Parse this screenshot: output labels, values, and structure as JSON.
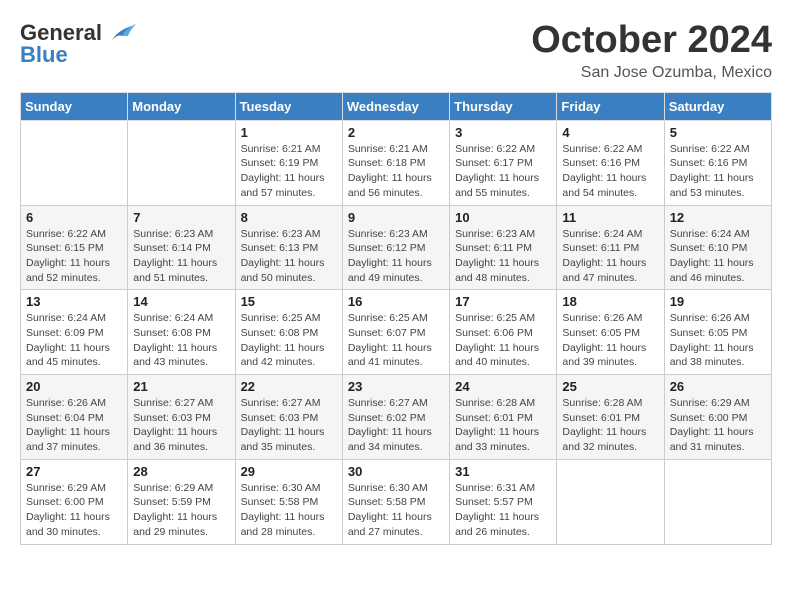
{
  "header": {
    "logo": {
      "line1": "General",
      "line2": "Blue"
    },
    "title": "October 2024",
    "location": "San Jose Ozumba, Mexico"
  },
  "weekdays": [
    "Sunday",
    "Monday",
    "Tuesday",
    "Wednesday",
    "Thursday",
    "Friday",
    "Saturday"
  ],
  "weeks": [
    [
      null,
      null,
      {
        "day": "1",
        "sunrise": "Sunrise: 6:21 AM",
        "sunset": "Sunset: 6:19 PM",
        "daylight": "Daylight: 11 hours and 57 minutes."
      },
      {
        "day": "2",
        "sunrise": "Sunrise: 6:21 AM",
        "sunset": "Sunset: 6:18 PM",
        "daylight": "Daylight: 11 hours and 56 minutes."
      },
      {
        "day": "3",
        "sunrise": "Sunrise: 6:22 AM",
        "sunset": "Sunset: 6:17 PM",
        "daylight": "Daylight: 11 hours and 55 minutes."
      },
      {
        "day": "4",
        "sunrise": "Sunrise: 6:22 AM",
        "sunset": "Sunset: 6:16 PM",
        "daylight": "Daylight: 11 hours and 54 minutes."
      },
      {
        "day": "5",
        "sunrise": "Sunrise: 6:22 AM",
        "sunset": "Sunset: 6:16 PM",
        "daylight": "Daylight: 11 hours and 53 minutes."
      }
    ],
    [
      {
        "day": "6",
        "sunrise": "Sunrise: 6:22 AM",
        "sunset": "Sunset: 6:15 PM",
        "daylight": "Daylight: 11 hours and 52 minutes."
      },
      {
        "day": "7",
        "sunrise": "Sunrise: 6:23 AM",
        "sunset": "Sunset: 6:14 PM",
        "daylight": "Daylight: 11 hours and 51 minutes."
      },
      {
        "day": "8",
        "sunrise": "Sunrise: 6:23 AM",
        "sunset": "Sunset: 6:13 PM",
        "daylight": "Daylight: 11 hours and 50 minutes."
      },
      {
        "day": "9",
        "sunrise": "Sunrise: 6:23 AM",
        "sunset": "Sunset: 6:12 PM",
        "daylight": "Daylight: 11 hours and 49 minutes."
      },
      {
        "day": "10",
        "sunrise": "Sunrise: 6:23 AM",
        "sunset": "Sunset: 6:11 PM",
        "daylight": "Daylight: 11 hours and 48 minutes."
      },
      {
        "day": "11",
        "sunrise": "Sunrise: 6:24 AM",
        "sunset": "Sunset: 6:11 PM",
        "daylight": "Daylight: 11 hours and 47 minutes."
      },
      {
        "day": "12",
        "sunrise": "Sunrise: 6:24 AM",
        "sunset": "Sunset: 6:10 PM",
        "daylight": "Daylight: 11 hours and 46 minutes."
      }
    ],
    [
      {
        "day": "13",
        "sunrise": "Sunrise: 6:24 AM",
        "sunset": "Sunset: 6:09 PM",
        "daylight": "Daylight: 11 hours and 45 minutes."
      },
      {
        "day": "14",
        "sunrise": "Sunrise: 6:24 AM",
        "sunset": "Sunset: 6:08 PM",
        "daylight": "Daylight: 11 hours and 43 minutes."
      },
      {
        "day": "15",
        "sunrise": "Sunrise: 6:25 AM",
        "sunset": "Sunset: 6:08 PM",
        "daylight": "Daylight: 11 hours and 42 minutes."
      },
      {
        "day": "16",
        "sunrise": "Sunrise: 6:25 AM",
        "sunset": "Sunset: 6:07 PM",
        "daylight": "Daylight: 11 hours and 41 minutes."
      },
      {
        "day": "17",
        "sunrise": "Sunrise: 6:25 AM",
        "sunset": "Sunset: 6:06 PM",
        "daylight": "Daylight: 11 hours and 40 minutes."
      },
      {
        "day": "18",
        "sunrise": "Sunrise: 6:26 AM",
        "sunset": "Sunset: 6:05 PM",
        "daylight": "Daylight: 11 hours and 39 minutes."
      },
      {
        "day": "19",
        "sunrise": "Sunrise: 6:26 AM",
        "sunset": "Sunset: 6:05 PM",
        "daylight": "Daylight: 11 hours and 38 minutes."
      }
    ],
    [
      {
        "day": "20",
        "sunrise": "Sunrise: 6:26 AM",
        "sunset": "Sunset: 6:04 PM",
        "daylight": "Daylight: 11 hours and 37 minutes."
      },
      {
        "day": "21",
        "sunrise": "Sunrise: 6:27 AM",
        "sunset": "Sunset: 6:03 PM",
        "daylight": "Daylight: 11 hours and 36 minutes."
      },
      {
        "day": "22",
        "sunrise": "Sunrise: 6:27 AM",
        "sunset": "Sunset: 6:03 PM",
        "daylight": "Daylight: 11 hours and 35 minutes."
      },
      {
        "day": "23",
        "sunrise": "Sunrise: 6:27 AM",
        "sunset": "Sunset: 6:02 PM",
        "daylight": "Daylight: 11 hours and 34 minutes."
      },
      {
        "day": "24",
        "sunrise": "Sunrise: 6:28 AM",
        "sunset": "Sunset: 6:01 PM",
        "daylight": "Daylight: 11 hours and 33 minutes."
      },
      {
        "day": "25",
        "sunrise": "Sunrise: 6:28 AM",
        "sunset": "Sunset: 6:01 PM",
        "daylight": "Daylight: 11 hours and 32 minutes."
      },
      {
        "day": "26",
        "sunrise": "Sunrise: 6:29 AM",
        "sunset": "Sunset: 6:00 PM",
        "daylight": "Daylight: 11 hours and 31 minutes."
      }
    ],
    [
      {
        "day": "27",
        "sunrise": "Sunrise: 6:29 AM",
        "sunset": "Sunset: 6:00 PM",
        "daylight": "Daylight: 11 hours and 30 minutes."
      },
      {
        "day": "28",
        "sunrise": "Sunrise: 6:29 AM",
        "sunset": "Sunset: 5:59 PM",
        "daylight": "Daylight: 11 hours and 29 minutes."
      },
      {
        "day": "29",
        "sunrise": "Sunrise: 6:30 AM",
        "sunset": "Sunset: 5:58 PM",
        "daylight": "Daylight: 11 hours and 28 minutes."
      },
      {
        "day": "30",
        "sunrise": "Sunrise: 6:30 AM",
        "sunset": "Sunset: 5:58 PM",
        "daylight": "Daylight: 11 hours and 27 minutes."
      },
      {
        "day": "31",
        "sunrise": "Sunrise: 6:31 AM",
        "sunset": "Sunset: 5:57 PM",
        "daylight": "Daylight: 11 hours and 26 minutes."
      },
      null,
      null
    ]
  ]
}
